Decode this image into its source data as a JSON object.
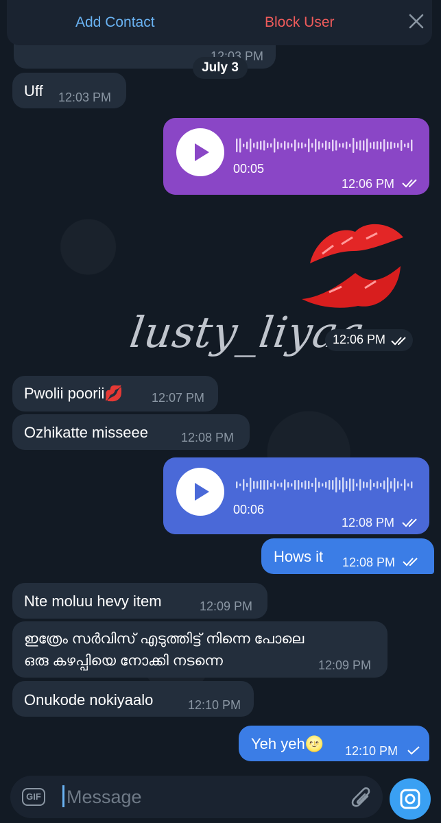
{
  "header": {
    "add_contact": "Add Contact",
    "block_user": "Block User",
    "close_icon": "close-icon"
  },
  "partial_message": {
    "time": "12:03 PM"
  },
  "date_label": "July 3",
  "messages": [
    {
      "dir": "in",
      "text": "Uff",
      "time": "12:03 PM"
    },
    {
      "dir": "out",
      "type": "voice",
      "duration": "00:05",
      "time": "12:06 PM",
      "color": "#8a46c6"
    },
    {
      "dir": "out",
      "type": "sticker",
      "sticker": "kiss-lips",
      "caption": "lusty_liyaa",
      "time": "12:06 PM"
    },
    {
      "dir": "in",
      "text": "Pwolii poorii💋",
      "time": "12:07 PM"
    },
    {
      "dir": "in",
      "text": "Ozhikatte misseee",
      "time": "12:08 PM"
    },
    {
      "dir": "out",
      "type": "voice",
      "duration": "00:06",
      "time": "12:08 PM",
      "color": "#4a69d8"
    },
    {
      "dir": "out",
      "text": "Hows it",
      "time": "12:08 PM"
    },
    {
      "dir": "in",
      "text": "Nte moluu hevy item",
      "time": "12:09 PM"
    },
    {
      "dir": "in",
      "line1": "ഇത്രേം സർവിസ് എടുത്തിട്ട് നിന്നെ പോലെ",
      "line2": "ഒരു കഴപ്പിയെ നോക്കി നടന്നെ",
      "time": "12:09 PM"
    },
    {
      "dir": "in",
      "text": "Onukode nokiyaalo",
      "time": "12:10 PM"
    },
    {
      "dir": "out",
      "text": "Yeh yeh🌝",
      "time": "12:10 PM"
    }
  ],
  "input": {
    "gif_label": "GIF",
    "placeholder": "Message",
    "attach_icon": "paperclip-icon",
    "camera_icon": "camera-icon"
  },
  "colors": {
    "accent": "#3aa0f3",
    "link": "#6ab3f3",
    "danger": "#ef5b5b",
    "incoming": "#232e3c"
  }
}
